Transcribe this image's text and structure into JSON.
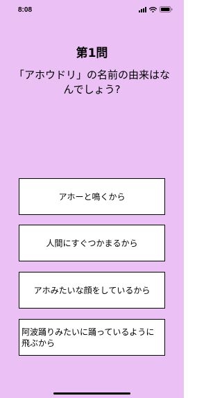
{
  "status_bar": {
    "time": "8:08"
  },
  "question": {
    "number_label": "第1問",
    "text": "「アホウドリ」の名前の由来はなんでしょう?"
  },
  "answers": [
    {
      "label": "アホーと鳴くから"
    },
    {
      "label": "人間にすぐつかまるから"
    },
    {
      "label": "アホみたいな顔をしているから"
    },
    {
      "label": "阿波踊りみたいに踊っているように飛ぶから"
    }
  ],
  "colors": {
    "background": "#EBC0F5",
    "button_background": "#FFFFFF",
    "button_border": "#000000"
  },
  "icons": [
    "signal-icon",
    "wifi-icon",
    "battery-icon"
  ]
}
